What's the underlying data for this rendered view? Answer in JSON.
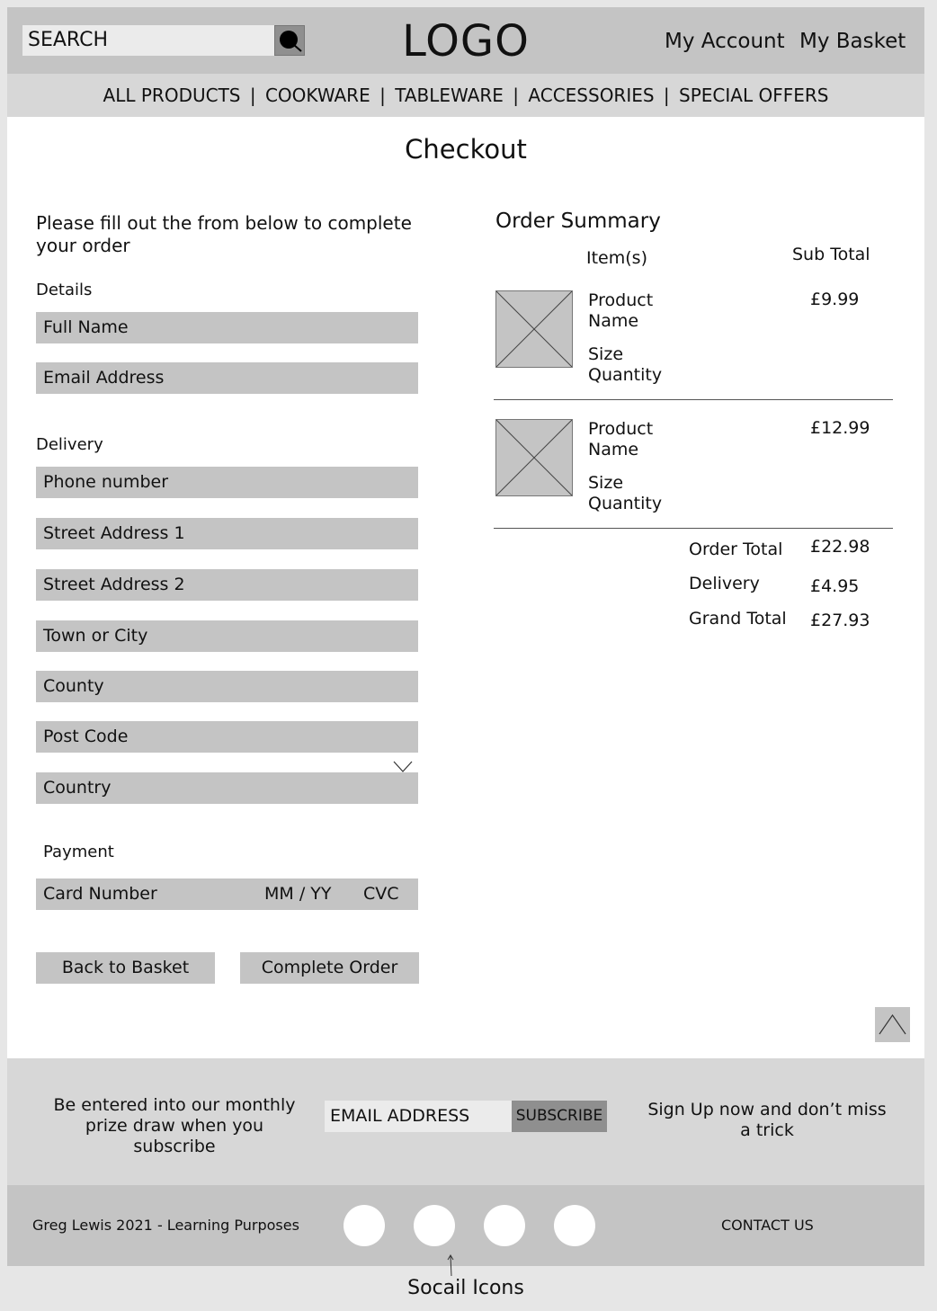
{
  "header": {
    "search_label": "SEARCH",
    "logo": "LOGO",
    "my_account": "My Account",
    "my_basket": "My Basket"
  },
  "nav": {
    "items": [
      "ALL PRODUCTS",
      "COOKWARE",
      "TABLEWARE",
      "ACCESSORIES",
      "SPECIAL OFFERS"
    ],
    "separator": "|"
  },
  "page": {
    "title": "Checkout"
  },
  "form": {
    "intro": "Please fill out the from below to complete your order",
    "details": {
      "label": "Details",
      "full_name": "Full Name",
      "email": "Email Address"
    },
    "delivery": {
      "label": "Delivery",
      "phone": "Phone number",
      "street1": "Street Address 1",
      "street2": "Street Address 2",
      "town": "Town or City",
      "county": "County",
      "post_code": "Post Code",
      "country": "Country"
    },
    "payment": {
      "label": "Payment",
      "card_number": "Card Number",
      "expiry": "MM / YY",
      "cvc": "CVC"
    },
    "buttons": {
      "back": "Back to Basket",
      "complete": "Complete Order"
    }
  },
  "summary": {
    "title": "Order Summary",
    "col_items": "Item(s)",
    "col_subtotal": "Sub Total",
    "items": [
      {
        "name_line1": "Product",
        "name_line2": "Name",
        "size": "Size",
        "quantity": "Quantity",
        "price": "£9.99"
      },
      {
        "name_line1": "Product",
        "name_line2": "Name",
        "size": "Size",
        "quantity": "Quantity",
        "price": "£12.99"
      }
    ],
    "totals": {
      "order_total_label": "Order Total",
      "order_total": "£22.98",
      "delivery_label": "Delivery",
      "delivery": "£4.95",
      "grand_total_label": "Grand Total",
      "grand_total": "£27.93"
    }
  },
  "newsletter": {
    "left_text": "Be entered into our monthly prize draw when you subscribe",
    "email_placeholder": "EMAIL ADDRESS",
    "subscribe": "SUBSCRIBE",
    "right_text": "Sign Up now and don’t miss a trick"
  },
  "footer": {
    "credit": "Greg Lewis 2021 - Learning Purposes",
    "contact": "CONTACT US",
    "annotation": "Socail Icons"
  }
}
